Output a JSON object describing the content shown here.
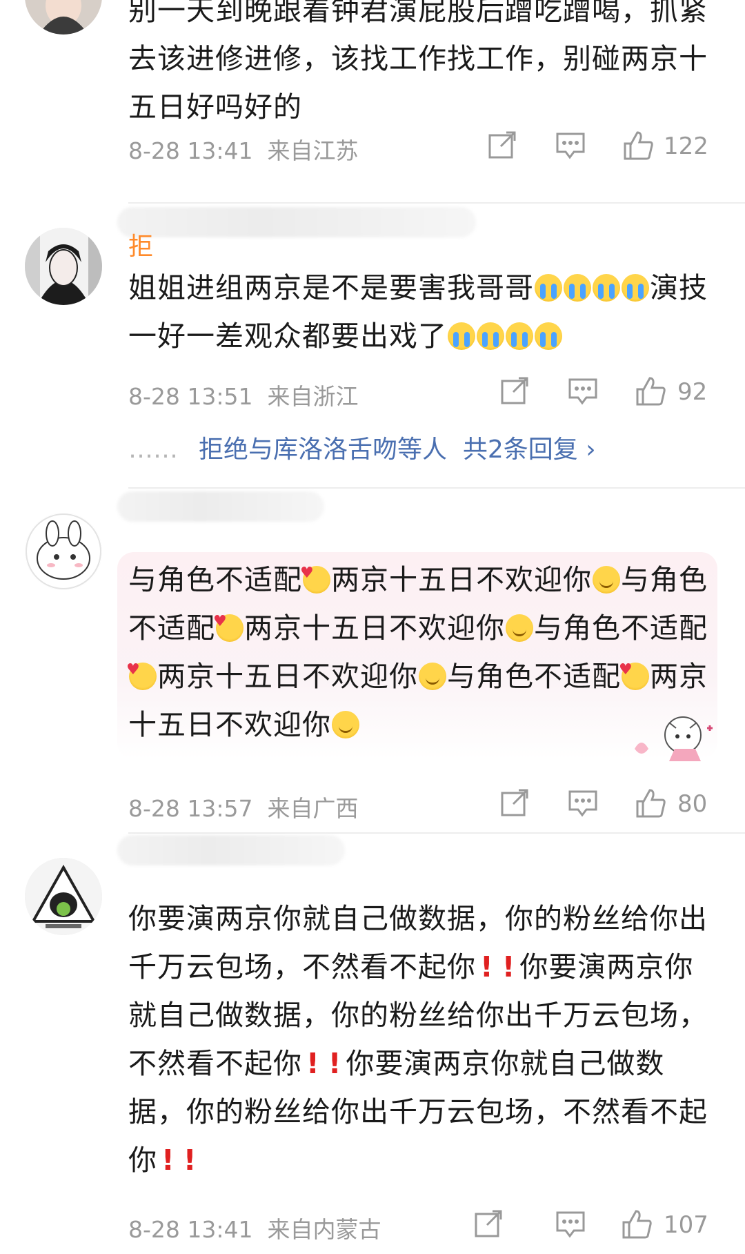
{
  "comments": [
    {
      "text": "别一天到晚跟着钟君演屁股后蹭吃蹭喝，抓紧去该进修进修，该找工作找工作，别碰两京十五日好吗好的",
      "time": "8-28 13:41",
      "location": "来自江苏",
      "likes": "122"
    },
    {
      "name_fragment": "拒",
      "text_a": "姐姐进组两京是不是要害我哥哥",
      "text_b": "演技一好一差观众都要出戏了",
      "time": "8-28 13:51",
      "location": "来自浙江",
      "likes": "92",
      "reply_dots": "……",
      "reply_text": "拒绝与库洛洛舌吻等人",
      "reply_count": "共2条回复 ›"
    },
    {
      "text_seg": "与角色不适配",
      "text_seg2": "两京十五日不欢迎你",
      "time": "8-28 13:57",
      "location": "来自广西",
      "likes": "80"
    },
    {
      "text_seg": "你要演两京你就自己做数据，你的粉丝给你出千万云包场，不然看不起你",
      "time": "8-28 13:41",
      "location": "来自内蒙古",
      "likes": "107"
    }
  ],
  "icons": {
    "share": "share-icon",
    "comment": "comment-icon",
    "like": "thumbs-up-icon"
  },
  "colors": {
    "meta_gray": "#9a9a9a",
    "link_blue": "#4a6fb0",
    "exclamation_red": "#e02020"
  }
}
